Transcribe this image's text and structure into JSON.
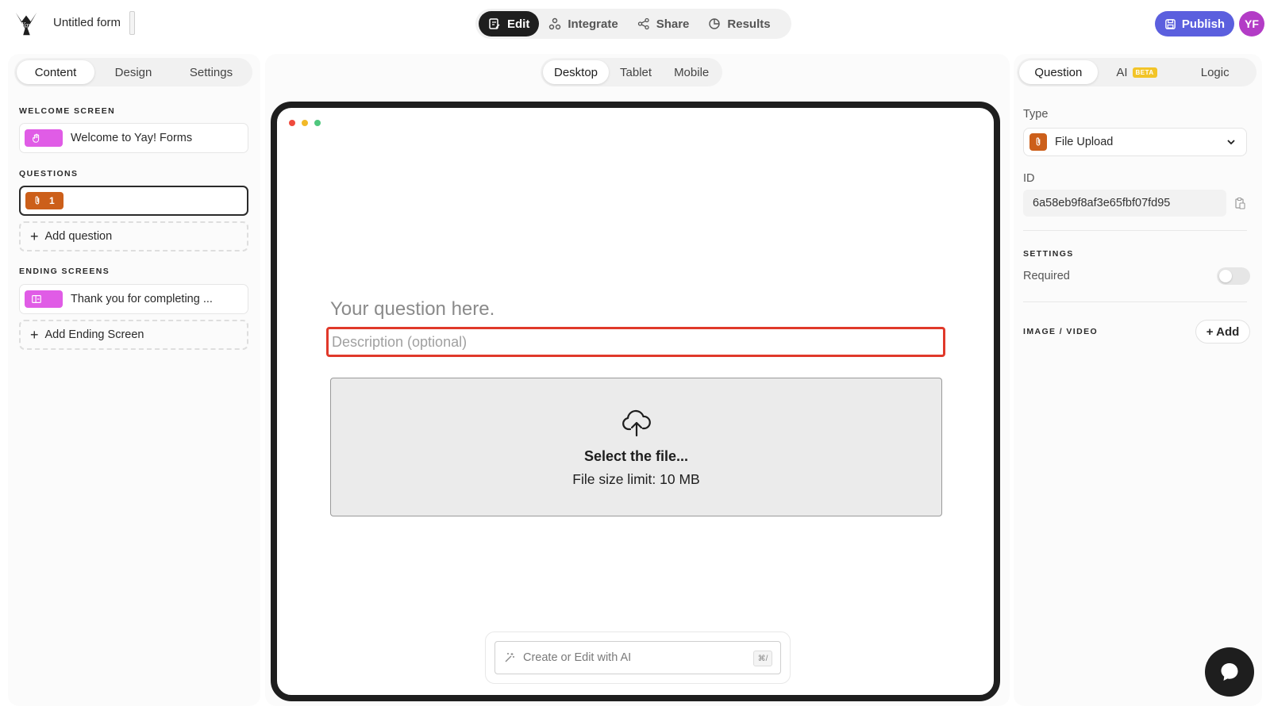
{
  "header": {
    "form_title": "Untitled form",
    "nav": [
      {
        "label": "Edit",
        "icon": "edit-icon",
        "active": true
      },
      {
        "label": "Integrate",
        "icon": "integrate-icon"
      },
      {
        "label": "Share",
        "icon": "share-icon"
      },
      {
        "label": "Results",
        "icon": "results-icon"
      }
    ],
    "publish_label": "Publish",
    "avatar_initials": "YF"
  },
  "left_panel": {
    "tabs": [
      "Content",
      "Design",
      "Settings"
    ],
    "active_tab": "Content",
    "welcome_label": "WELCOME SCREEN",
    "welcome_item": "Welcome to Yay! Forms",
    "questions_label": "QUESTIONS",
    "question_number": "1",
    "add_question": "Add question",
    "ending_label": "ENDING SCREENS",
    "ending_item": "Thank you for completing ...",
    "add_ending": "Add Ending Screen"
  },
  "center": {
    "devices": [
      "Desktop",
      "Tablet",
      "Mobile"
    ],
    "active_device": "Desktop",
    "question_placeholder": "Your question here.",
    "description_placeholder": "Description (optional)",
    "upload_title": "Select the file...",
    "upload_limit": "File size limit: 10 MB",
    "ai_placeholder": "Create or Edit with AI",
    "ai_shortcut": "⌘/"
  },
  "right_panel": {
    "tabs": [
      "Question",
      "AI",
      "Logic"
    ],
    "active_tab": "Question",
    "beta_badge": "BETA",
    "type_label": "Type",
    "type_value": "File Upload",
    "id_label": "ID",
    "id_value": "6a58eb9f8af3e65fbf07fd95",
    "settings_label": "SETTINGS",
    "required_label": "Required",
    "required_on": false,
    "media_label": "IMAGE / VIDEO",
    "add_label": "+ Add"
  },
  "colors": {
    "accent": "#5b5fde",
    "avatar": "#b33cc6",
    "welcome_chip": "#e05ce6",
    "question_chip": "#cc5f1a",
    "highlight": "#e0392a",
    "beta": "#f2c428"
  }
}
